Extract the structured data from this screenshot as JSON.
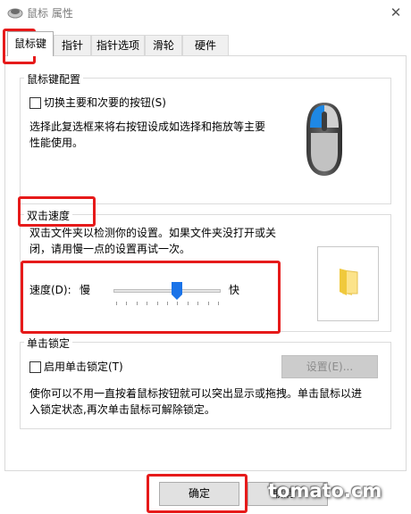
{
  "window": {
    "title": "鼠标 属性",
    "close_glyph": "✕"
  },
  "tabs": [
    {
      "label": "鼠标键",
      "active": true
    },
    {
      "label": "指针"
    },
    {
      "label": "指针选项"
    },
    {
      "label": "滑轮"
    },
    {
      "label": "硬件"
    }
  ],
  "button_config": {
    "legend": "鼠标键配置",
    "switch_checkbox_label": "切换主要和次要的按钮(S)",
    "switch_checked": false,
    "description": [
      "选择此复选框来将右按钮设成如选择和拖放等主要",
      "性能使用。"
    ],
    "mouse_icon": "mouse-icon"
  },
  "double_click": {
    "legend": "双击速度",
    "description": [
      "双击文件夹以检测你的设置。如果文件夹没打开或关",
      "闭，请用慢一点的设置再试一次。"
    ],
    "speed_label": "速度(D):",
    "slow_label": "慢",
    "fast_label": "快",
    "speed_fraction": 0.6,
    "test_folder_icon": "folder-icon"
  },
  "click_lock": {
    "legend": "单击锁定",
    "enable_checkbox_label": "启用单击锁定(T)",
    "enable_checked": false,
    "settings_button": "设置(E)...",
    "description": [
      "使你可以不用一直按着鼠标按钮就可以突出显示或拖拽。单击鼠标以进",
      "入锁定状态,再次单击鼠标可解除锁定。"
    ]
  },
  "footer": {
    "ok_button": "确定",
    "cancel_button": "取消"
  },
  "watermark": "tomato.cm",
  "colors": {
    "highlight": "#e61a1a",
    "mouse_accent": "#1e88e5"
  }
}
